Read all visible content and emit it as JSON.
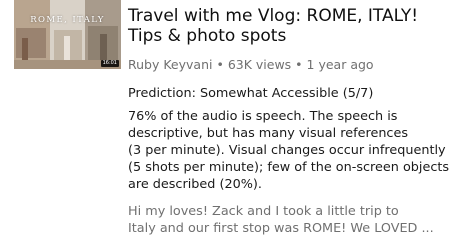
{
  "video": {
    "thumbnail": {
      "caption": "ROME, ITALY",
      "duration": "16:01"
    },
    "title_line1": "Travel with me Vlog: ROME, ITALY!",
    "title_line2": "Tips & photo spots",
    "channel": "Ruby Keyvani",
    "views": "63K views",
    "age": "1 year ago",
    "separator": "•"
  },
  "accessibility": {
    "prediction": "Prediction: Somewhat Accessible (5/7)",
    "analysis_lines": [
      "76% of the audio is speech. The speech is",
      "descriptive, but has many visual references",
      "(3 per minute). Visual changes occur infrequently",
      "(5 shots per minute); few of the on-screen objects",
      "are described (20%)."
    ]
  },
  "description": {
    "lines": [
      "Hi my loves! Zack and I took a little trip to",
      "Italy and our first stop was ROME! We LOVED ..."
    ]
  }
}
